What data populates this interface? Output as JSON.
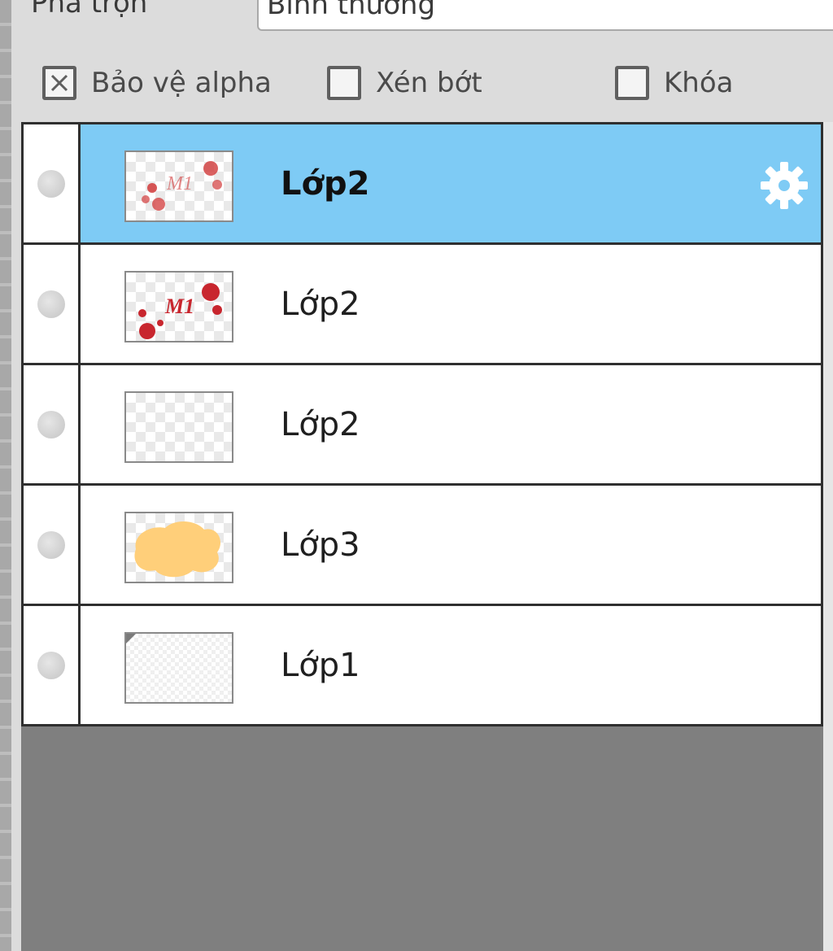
{
  "blend": {
    "label": "Phả trộn",
    "value": "Bình thường"
  },
  "options": [
    {
      "label": "Bảo vệ alpha",
      "checked": true
    },
    {
      "label": "Xén bớt",
      "checked": false
    },
    {
      "label": "Khóa",
      "checked": false
    }
  ],
  "layers": [
    {
      "name": "Lớp2",
      "selected": true
    },
    {
      "name": "Lớp2",
      "selected": false
    },
    {
      "name": "Lớp2",
      "selected": false
    },
    {
      "name": "Lớp3",
      "selected": false
    },
    {
      "name": "Lớp1",
      "selected": false
    }
  ],
  "colors": {
    "selected_row": "#7ecbf5",
    "panel_bg": "#dcdcdc",
    "empty_area": "#7f7f7f",
    "thumb_red": "#d13a3a",
    "thumb_orange": "#ffcf7a"
  },
  "icons": {
    "visibility": "visibility-dot-icon",
    "settings": "gear-icon",
    "checkbox": "checkbox-icon"
  }
}
